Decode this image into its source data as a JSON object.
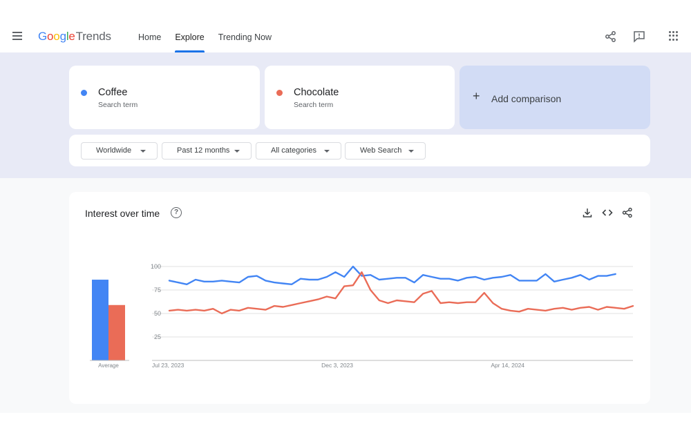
{
  "app": {
    "logo": {
      "g1": "G",
      "o1": "o",
      "o2": "o",
      "g2": "g",
      "l": "l",
      "e": "e",
      "suffix": "Trends"
    }
  },
  "header": {
    "nav": [
      {
        "label": "Home"
      },
      {
        "label": "Explore"
      },
      {
        "label": "Trending Now"
      }
    ],
    "icons": [
      "menu-icon",
      "share-icon",
      "feedback-icon",
      "apps-icon"
    ]
  },
  "search": {
    "terms": [
      {
        "name": "Coffee",
        "subtitle": "Search term",
        "color": "#4285f4"
      },
      {
        "name": "Chocolate",
        "subtitle": "Search term",
        "color": "#ea6c57"
      }
    ],
    "add_comparison": {
      "icon": "plus-icon",
      "label": "Add comparison"
    },
    "filters": [
      {
        "label": "Worldwide"
      },
      {
        "label": "Past 12 months"
      },
      {
        "label": "All categories"
      },
      {
        "label": "Web Search"
      }
    ]
  },
  "interest_card": {
    "title": "Interest over time",
    "help_icon": "?",
    "icons": [
      "download-icon",
      "embed-icon",
      "share-icon"
    ]
  },
  "chart_data": {
    "type": "line",
    "title": "Interest over time",
    "ylim": [
      0,
      100
    ],
    "yticks": [
      "100",
      "75",
      "50",
      "25"
    ],
    "xtick_labels": [
      "Jul 23, 2023",
      "Dec 3, 2023",
      "Apr 14, 2024"
    ],
    "xtick_weeks": [
      0,
      19,
      38
    ],
    "grid": true,
    "average": {
      "label": "Average",
      "values": [
        86,
        59
      ]
    },
    "series": [
      {
        "name": "Coffee",
        "color": "#4285f4",
        "values": [
          85,
          83,
          81,
          86,
          84,
          84,
          85,
          84,
          83,
          89,
          90,
          85,
          83,
          82,
          81,
          87,
          86,
          86,
          89,
          94,
          89,
          100,
          90,
          91,
          86,
          87,
          88,
          88,
          83,
          91,
          89,
          87,
          87,
          85,
          88,
          89,
          86,
          88,
          89,
          91,
          85,
          85,
          85,
          92,
          84,
          86,
          88,
          91,
          86,
          90,
          90,
          92
        ]
      },
      {
        "name": "Chocolate",
        "color": "#ea6c57",
        "values": [
          53,
          54,
          53,
          54,
          53,
          55,
          50,
          54,
          53,
          56,
          55,
          54,
          58,
          57,
          59,
          61,
          63,
          65,
          68,
          66,
          79,
          80,
          94,
          75,
          64,
          61,
          64,
          63,
          62,
          71,
          74,
          61,
          62,
          61,
          62,
          62,
          72,
          61,
          55,
          53,
          52,
          55,
          54,
          53,
          55,
          56,
          54,
          56,
          57,
          54,
          57,
          56,
          55,
          58
        ]
      }
    ]
  }
}
